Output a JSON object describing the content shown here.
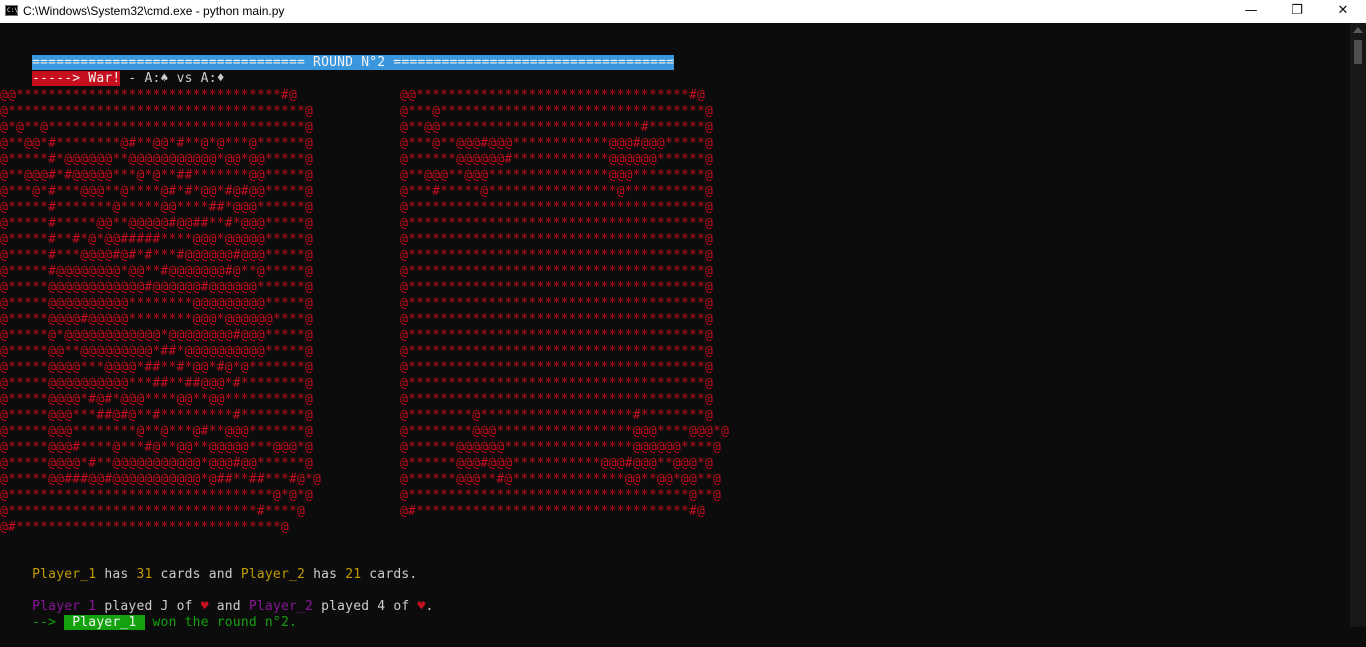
{
  "window": {
    "title": "C:\\Windows\\System32\\cmd.exe - python  main.py",
    "icon": "cmd-icon",
    "minimize_glyph": "—",
    "maximize_glyph": "❐",
    "close_glyph": "✕"
  },
  "round": {
    "banner": "================================== ROUND N°2 ==================================="
  },
  "war": {
    "label": "-----> War!",
    "text": " - A:♠ vs A:♦"
  },
  "cards": {
    "left": [
      "@@*********************************#@",
      "@*************************************@",
      "@*@**@********************************@",
      "@**@@*#********@#**@@*#**@*@***@******@",
      "@*****#*@@@@@@**@@@@@@@@@@@*@@*@@*****@",
      "@**@@@#*#@@@@@***@*@**##*******@@*****@",
      "@***@*#***@@@**@****@#*#*@@*#@#@@*****@",
      "@*****#*******@*****@@****##*@@@******@",
      "@*****#*****@@**@@@@@#@@##**#*@@@*****@",
      "@*****#**#*@*@@#####****@@@*@@@@@*****@",
      "@*****#***@@@@#@#*#***#@@@@@@#@@@*****@",
      "@*****#@@@@@@@@*@@**#@@@@@@@#@**@*****@",
      "@*****@@@@@@@@@@@@#@@@@@@#@@@@@@******@",
      "@*****@@@@@@@@@@********@@@@@@@@@*****@",
      "@*****@@@@#@@@@@********@@@*@@@@@@****@",
      "@*****@*@@@@@@@@@@@@*@@@@@@@@#@@@*****@",
      "@*****@@**@@@@@@@@@*##*@@@@@@@@@@*****@",
      "@*****@@@@***@@@@*##**#*@@*#@*@*******@",
      "@*****@@@@@@@@@@***##**##@@@*#********@",
      "@*****@@@@*#@#*@@@****@@**@@**********@",
      "@*****@@@***##@#@**#*********#********@",
      "@*****@@@********@**@***@#**@@@*******@",
      "@*****@@@#****@***#@**@@**@@@@@***@@@*@",
      "@*****@@@@*#**@@@@@@@@@@@*@@@#@@******@",
      "@*****@@###@@#@@@@@@@@@@@*@##**##***#@*@",
      "@*********************************@*@*@",
      "@*******************************#****@",
      "@#*********************************@"
    ],
    "right": [
      "@@**********************************#@",
      "@***@*********************************@",
      "@**@@*************************#*******@",
      "@***@**@@@#@@@************@@@#@@@*****@",
      "@******@@@@@@#************@@@@@@******@",
      "@**@@@**@@@***************@@@*********@",
      "@***#*****@****************@**********@",
      "@*************************************@",
      "@*************************************@",
      "@*************************************@",
      "@*************************************@",
      "@*************************************@",
      "@*************************************@",
      "@*************************************@",
      "@*************************************@",
      "@*************************************@",
      "@*************************************@",
      "@*************************************@",
      "@*************************************@",
      "@*************************************@",
      "@********@*******************#********@",
      "@********@@@*****************@@@****@@@*@",
      "@******@@@@@@****************@@@@@@****@",
      "@******@@@#@@@***********@@@#@@@**@@@*@",
      "@******@@@**#@**************@@**@@*@@**@",
      "@***********************************@**@",
      "@#**********************************#@"
    ]
  },
  "status": {
    "p1_name": "Player_1",
    "has1": " has ",
    "p1_count": "31",
    "cards_and": " cards and ",
    "p2_name": "Player_2",
    "has2": " has ",
    "p2_count": "21",
    "cards_end": " cards."
  },
  "played": {
    "p1_name": "Player 1",
    "p1_played": " played J of ",
    "p1_suit": "♥",
    "and": " and ",
    "p2_name": "Player_2",
    "p2_played": " played 4 of ",
    "p2_suit": "♥",
    "end": "."
  },
  "result": {
    "arrow": "--> ",
    "winner": " Player_1 ",
    "text": " won the round n°2."
  }
}
